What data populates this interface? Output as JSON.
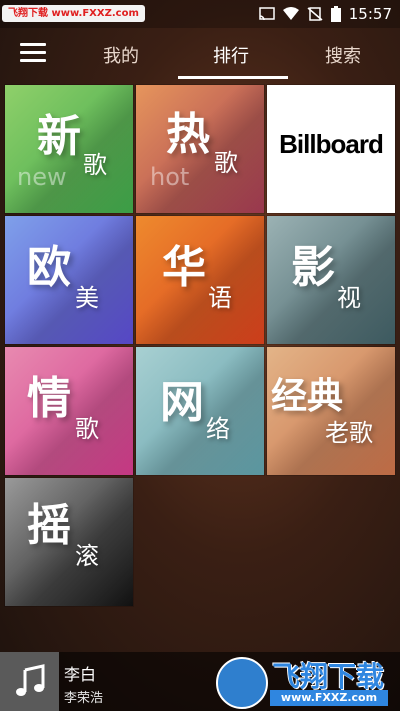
{
  "status_bar": {
    "watermark": "飞翔下载 www.FXXZ.com",
    "time": "15:57",
    "icons": [
      "cast-icon",
      "wifi-icon",
      "no-sim-icon",
      "battery-icon"
    ]
  },
  "nav": {
    "tabs": [
      {
        "label": "我的"
      },
      {
        "label": "排行"
      },
      {
        "label": "搜索"
      }
    ],
    "active_tab": "排行"
  },
  "tiles": [
    {
      "big": "新",
      "small": "歌",
      "ghost": "new",
      "colors": [
        "#3ea64a",
        "#8fd06a"
      ]
    },
    {
      "big": "热",
      "small": "歌",
      "ghost": "hot",
      "colors": [
        "#a23a52",
        "#e6955c"
      ]
    },
    {
      "logo": "Billboard"
    },
    {
      "big": "欧",
      "small": "美",
      "colors": [
        "#5a4ad0",
        "#7fa0ea"
      ]
    },
    {
      "big": "华",
      "small": "语",
      "colors": [
        "#d8401c",
        "#ee8a2e"
      ]
    },
    {
      "big": "影",
      "small": "视",
      "colors": [
        "#3f5e64",
        "#9bb2b4"
      ]
    },
    {
      "big": "情",
      "small": "歌",
      "colors": [
        "#d03a8a",
        "#e88ab0"
      ]
    },
    {
      "big": "网",
      "small": "络",
      "colors": [
        "#5f9ea8",
        "#a8d0d2"
      ]
    },
    {
      "big": "经典",
      "small": "老歌",
      "colors": [
        "#c87048",
        "#e3b488"
      ]
    },
    {
      "big": "摇",
      "small": "滚",
      "colors": [
        "#111111",
        "#9a9a9a"
      ]
    }
  ],
  "player": {
    "song": "李白",
    "artist": "李荣浩"
  },
  "watermark_logo": {
    "text": "飞翔下载",
    "url": "www.FXXZ.com"
  }
}
